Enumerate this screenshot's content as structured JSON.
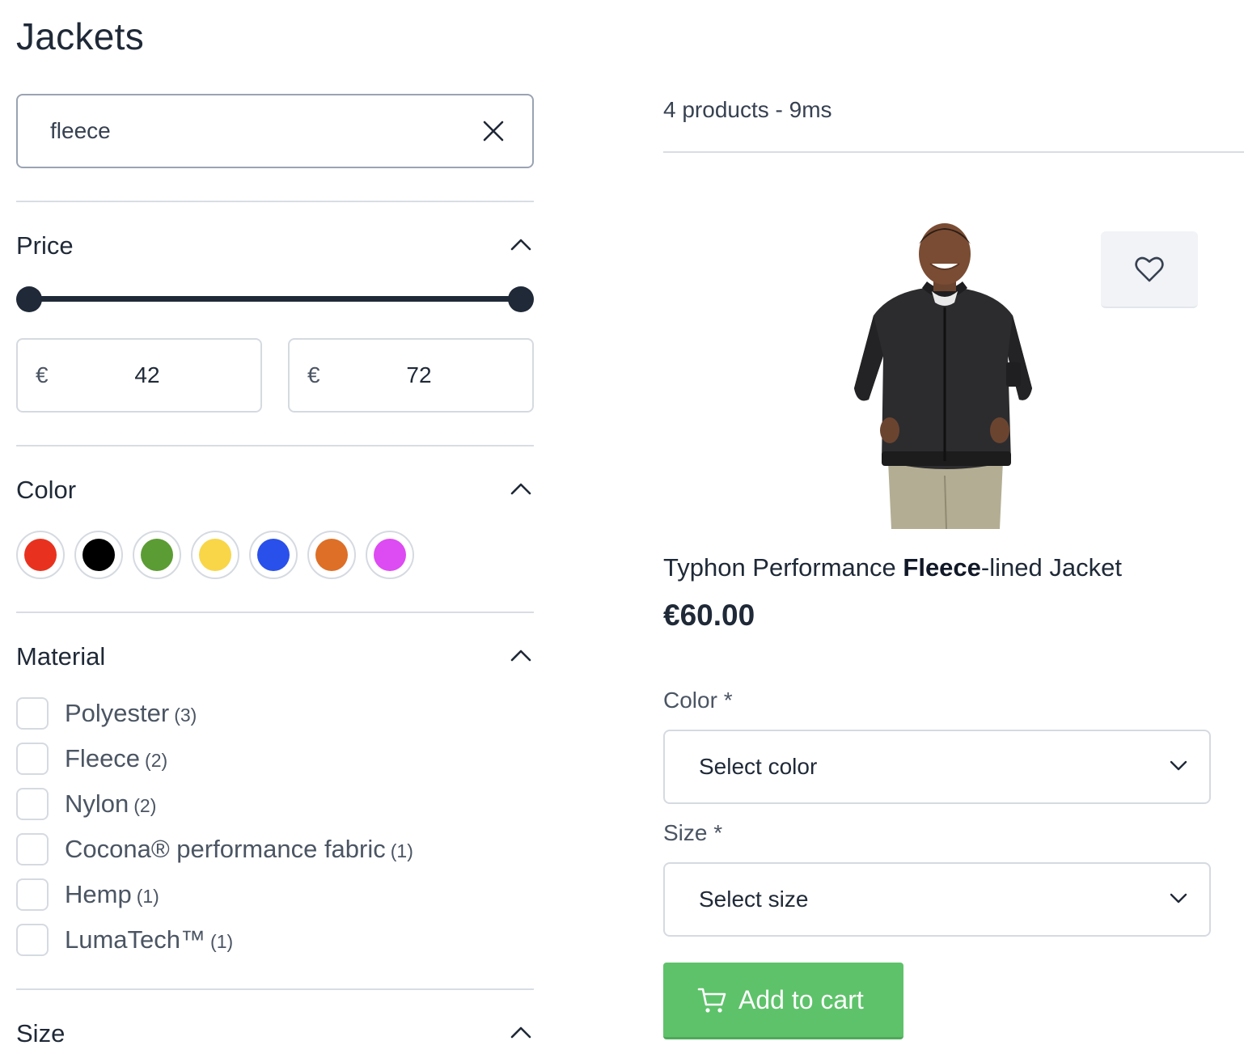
{
  "page": {
    "title": "Jackets"
  },
  "search": {
    "value": "fleece",
    "clear_icon": "close-icon"
  },
  "filters": {
    "price": {
      "title": "Price",
      "min": 42,
      "max": 72,
      "currency": "€",
      "range_selected_fraction": [
        0.0,
        1.0
      ]
    },
    "color": {
      "title": "Color",
      "swatches": [
        {
          "name": "red",
          "hex": "#e8321f"
        },
        {
          "name": "black",
          "hex": "#000000"
        },
        {
          "name": "green",
          "hex": "#5c9c34"
        },
        {
          "name": "yellow",
          "hex": "#f8d648"
        },
        {
          "name": "blue",
          "hex": "#2950ea"
        },
        {
          "name": "orange",
          "hex": "#de6f27"
        },
        {
          "name": "purple",
          "hex": "#dd4bf2"
        }
      ]
    },
    "material": {
      "title": "Material",
      "options": [
        {
          "label": "Polyester",
          "count": "(3)"
        },
        {
          "label": "Fleece",
          "count": "(2)"
        },
        {
          "label": "Nylon",
          "count": "(2)"
        },
        {
          "label": "Cocona® performance fabric",
          "count": "(1)"
        },
        {
          "label": "Hemp",
          "count": "(1)"
        },
        {
          "label": "LumaTech™",
          "count": "(1)"
        }
      ]
    },
    "size": {
      "title": "Size"
    }
  },
  "results": {
    "stats": "4 products - 9ms"
  },
  "product": {
    "name_prefix": "Typhon Performance ",
    "name_highlight": "Fleece",
    "name_suffix": "-lined Jacket",
    "price": "€60.00",
    "color_label": "Color *",
    "color_placeholder": "Select color",
    "size_label": "Size *",
    "size_placeholder": "Select size",
    "add_to_cart": "Add to cart",
    "wishlist_icon": "heart-icon",
    "cart_icon": "cart-icon"
  },
  "colors": {
    "text_primary": "#1f2937",
    "accent_green": "#5ec26a",
    "border": "#d5dae1"
  }
}
